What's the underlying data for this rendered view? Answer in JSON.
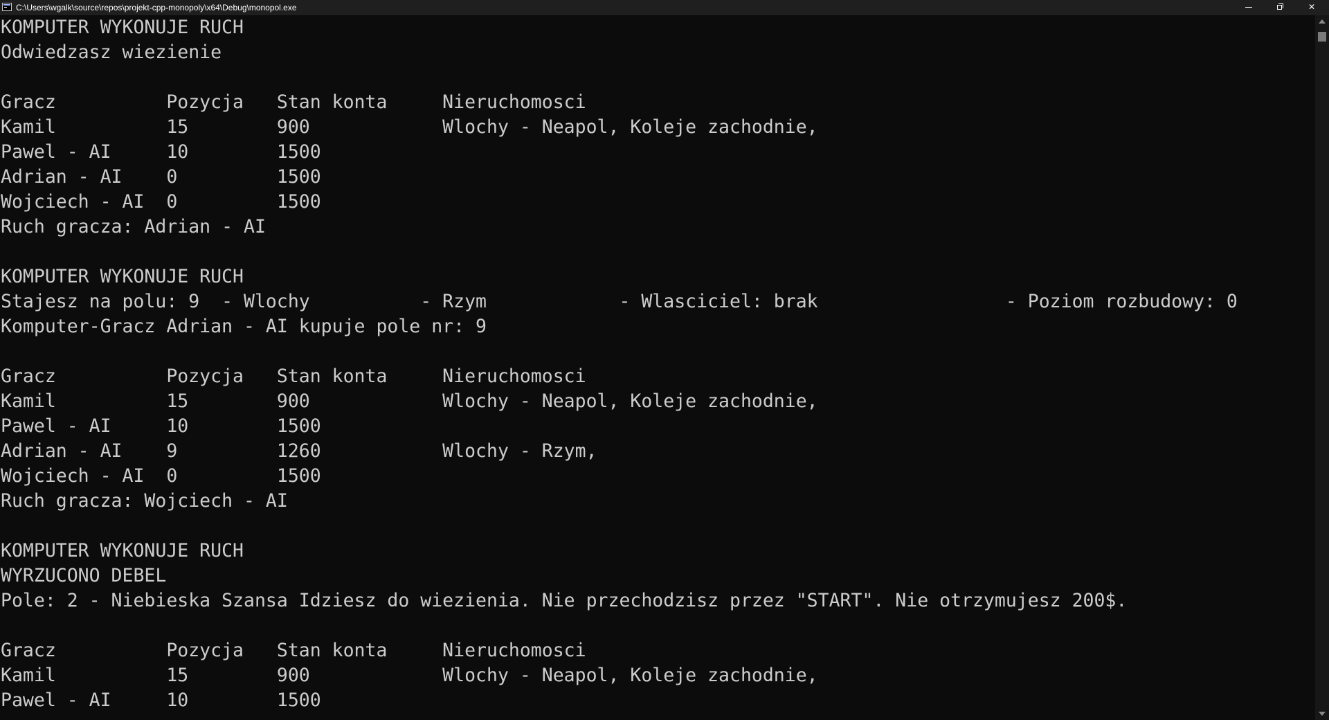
{
  "window": {
    "title": "C:\\Users\\wgalk\\source\\repos\\projekt-cpp-monopoly\\x64\\Debug\\monopol.exe",
    "app_icon": "console-icon",
    "controls": {
      "minimize_icon": "minimize-icon",
      "restore_icon": "restore-icon",
      "close_icon": "close-icon",
      "close_glyph": "✕"
    }
  },
  "console": {
    "lines": [
      "KOMPUTER WYKONUJE RUCH",
      "Odwiedzasz wiezienie",
      "",
      "Gracz          Pozycja   Stan konta     Nieruchomosci",
      "Kamil          15        900            Wlochy - Neapol, Koleje zachodnie,",
      "Pawel - AI     10        1500",
      "Adrian - AI    0         1500",
      "Wojciech - AI  0         1500",
      "Ruch gracza: Adrian - AI",
      "",
      "KOMPUTER WYKONUJE RUCH",
      "Stajesz na polu: 9  - Wlochy          - Rzym            - Wlasciciel: brak                 - Poziom rozbudowy: 0",
      "Komputer-Gracz Adrian - AI kupuje pole nr: 9",
      "",
      "Gracz          Pozycja   Stan konta     Nieruchomosci",
      "Kamil          15        900            Wlochy - Neapol, Koleje zachodnie,",
      "Pawel - AI     10        1500",
      "Adrian - AI    9         1260           Wlochy - Rzym,",
      "Wojciech - AI  0         1500",
      "Ruch gracza: Wojciech - AI",
      "",
      "KOMPUTER WYKONUJE RUCH",
      "WYRZUCONO DEBEL",
      "Pole: 2 - Niebieska Szansa Idziesz do wiezienia. Nie przechodzisz przez \"START\". Nie otrzymujesz 200$.",
      "",
      "Gracz          Pozycja   Stan konta     Nieruchomosci",
      "Kamil          15        900            Wlochy - Neapol, Koleje zachodnie,",
      "Pawel - AI     10        1500"
    ]
  },
  "scrollbar": {
    "up_icon": "scroll-up-arrow-icon",
    "down_icon": "scroll-down-arrow-icon"
  },
  "colors": {
    "background": "#0c0c0c",
    "text": "#cccccc",
    "titlebar": "#1f1f1f"
  }
}
